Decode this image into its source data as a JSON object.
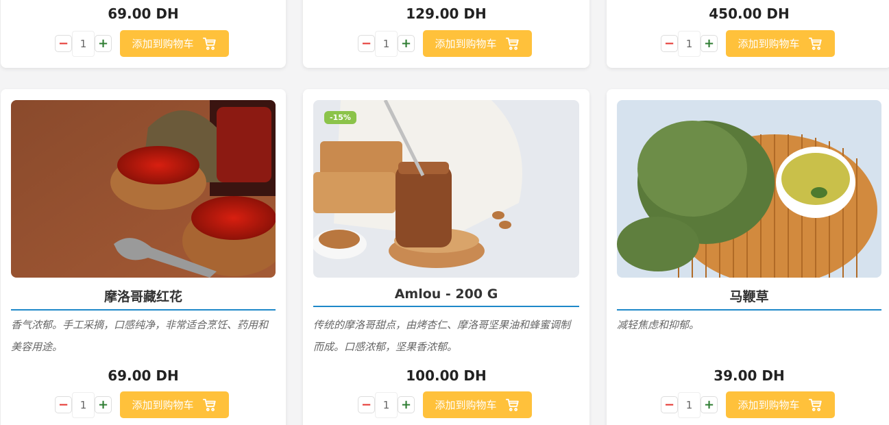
{
  "currency": "DH",
  "add_to_cart_label": "添加到购物车",
  "colors": {
    "accent_yellow": "#ffc13b",
    "title_underline": "#1e88c9",
    "badge_green": "#8bc34a",
    "minus_red": "#e53935",
    "plus_green": "#2e7d32"
  },
  "top_row": [
    {
      "price": "69.00 DH",
      "qty": "1"
    },
    {
      "price": "129.00 DH",
      "qty": "1"
    },
    {
      "price": "450.00 DH",
      "qty": "1"
    }
  ],
  "bottom_row": [
    {
      "title": "摩洛哥藏红花",
      "description": "香气浓郁。手工采摘，口感纯净，非常适合烹饪、药用和美容用途。",
      "price": "69.00 DH",
      "qty": "1",
      "image": "saffron-bowls-image",
      "badge": ""
    },
    {
      "title": "Amlou - 200 G",
      "description": "传统的摩洛哥甜点，由烤杏仁、摩洛哥坚果油和蜂蜜调制而成。口感浓郁，坚果香浓郁。",
      "price": "100.00 DH",
      "qty": "1",
      "image": "amlou-jar-image",
      "badge": "-15%"
    },
    {
      "title": "马鞭草",
      "description": "减轻焦虑和抑郁。",
      "price": "39.00 DH",
      "qty": "1",
      "image": "verbena-tea-image",
      "badge": ""
    }
  ]
}
